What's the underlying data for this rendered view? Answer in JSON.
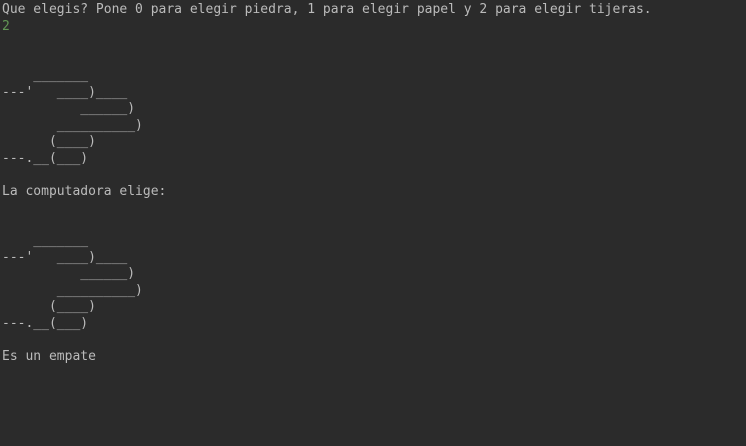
{
  "console": {
    "prompt": "Que elegis? Pone 0 para elegir piedra, 1 para elegir papel y 2 para elegir tijeras.",
    "user_input": "2",
    "player_art": [
      "    _______",
      "---'   ____)____",
      "          ______)",
      "       __________)",
      "      (____)",
      "---.__(___)"
    ],
    "computer_label": "La computadora elige:",
    "computer_art": [
      "    _______",
      "---'   ____)____",
      "          ______)",
      "       __________)",
      "      (____)",
      "---.__(___)"
    ],
    "result": "Es un empate"
  },
  "colors": {
    "background": "#2b2b2b",
    "text": "#bbbbbb",
    "input": "#629755"
  }
}
